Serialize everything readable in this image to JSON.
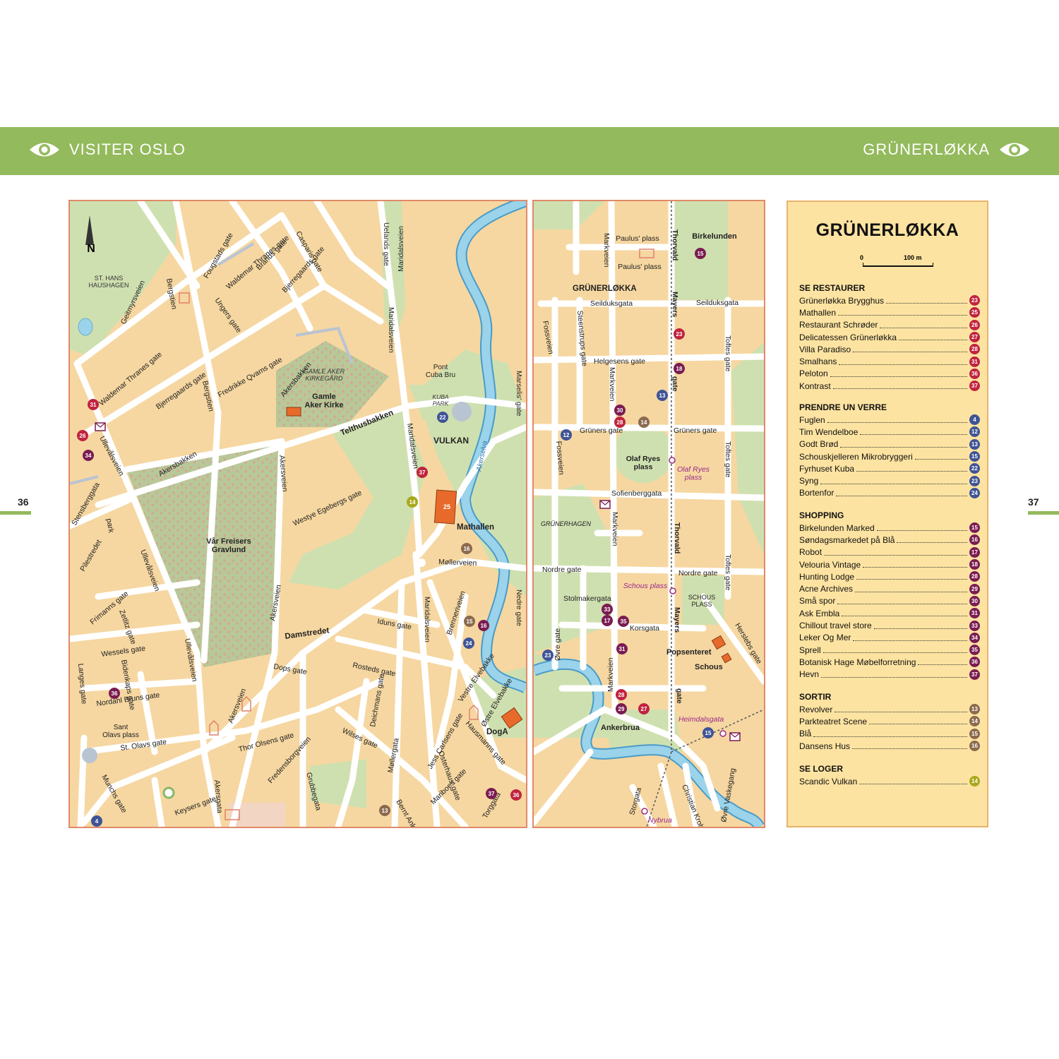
{
  "header": {
    "left_title": "VISITER OSLO",
    "right_title": "GRÜNERLØKKA"
  },
  "page_numbers": {
    "left": "36",
    "right": "37"
  },
  "colors": {
    "header_bar": "#93ba5c",
    "map_background": "#f6d7a1",
    "park": "#cfe0b0",
    "water": "#9ad3ea",
    "legend_background": "#fde3a1",
    "restaurant_badge": "#c0233f",
    "bar_badge": "#3f5496",
    "shopping_badge": "#7a1c52",
    "nightlife_badge": "#8b6a4e",
    "hotel_badge": "#a8a81c"
  },
  "legend": {
    "title": "GRÜNERLØKKA",
    "scale": {
      "zero": "0",
      "distance": "100 m"
    },
    "sections": [
      {
        "heading": "SE RESTAURER",
        "color": "#c0233f",
        "items": [
          {
            "name": "Grünerløkka Brygghus",
            "num": "23"
          },
          {
            "name": "Mathallen",
            "num": "25"
          },
          {
            "name": "Restaurant Schrøder",
            "num": "26"
          },
          {
            "name": "Delicatessen Grünerløkka",
            "num": "27"
          },
          {
            "name": "Villa Paradiso",
            "num": "28"
          },
          {
            "name": "Smalhans",
            "num": "31"
          },
          {
            "name": "Peloton",
            "num": "36"
          },
          {
            "name": "Kontrast",
            "num": "37"
          }
        ]
      },
      {
        "heading": "PRENDRE UN VERRE",
        "color": "#3f5496",
        "items": [
          {
            "name": "Fuglen",
            "num": "4"
          },
          {
            "name": "Tim Wendelboe",
            "num": "12"
          },
          {
            "name": "Godt Brød",
            "num": "13"
          },
          {
            "name": "Schouskjelleren Mikrobryggeri",
            "num": "15"
          },
          {
            "name": "Fyrhuset Kuba",
            "num": "22"
          },
          {
            "name": "Syng",
            "num": "23"
          },
          {
            "name": "Bortenfor",
            "num": "24"
          }
        ]
      },
      {
        "heading": "SHOPPING",
        "color": "#7a1c52",
        "items": [
          {
            "name": "Birkelunden Marked",
            "num": "15"
          },
          {
            "name": "Søndagsmarkedet på Blå",
            "num": "16"
          },
          {
            "name": "Robot",
            "num": "17"
          },
          {
            "name": "Velouria Vintage",
            "num": "18"
          },
          {
            "name": "Hunting Lodge",
            "num": "28"
          },
          {
            "name": "Acne Archives",
            "num": "29"
          },
          {
            "name": "Små spor",
            "num": "30"
          },
          {
            "name": "Ask Embla",
            "num": "31"
          },
          {
            "name": "Chillout travel store",
            "num": "33"
          },
          {
            "name": "Leker Og Mer",
            "num": "34"
          },
          {
            "name": "Sprell",
            "num": "35"
          },
          {
            "name": "Botanisk Hage Møbelforretning",
            "num": "36"
          },
          {
            "name": "Hevn",
            "num": "37"
          }
        ]
      },
      {
        "heading": "SORTIR",
        "color": "#8b6a4e",
        "items": [
          {
            "name": "Revolver",
            "num": "13"
          },
          {
            "name": "Parkteatret Scene",
            "num": "14"
          },
          {
            "name": "Blå",
            "num": "15"
          },
          {
            "name": "Dansens Hus",
            "num": "16"
          }
        ]
      },
      {
        "heading": "SE LOGER",
        "color": "#a8a81c",
        "items": [
          {
            "name": "Scandic Vulkan",
            "num": "14"
          }
        ]
      }
    ]
  },
  "map_left": {
    "compass": "N",
    "places": {
      "st_hans": "ST. HANS\nHAUSHAGEN",
      "gamle_aker_kirkegard": "GAMLE AKER\nKIRKEGÅRD",
      "gamle_aker_kirke": "Gamle\nAker Kirke",
      "var_freisers": "Vår Freisers\nGravlund",
      "vulkan": "VULKAN",
      "kuba_park": "KUBA\nPARK",
      "pont_cuba": "Pont\nCuba Bru",
      "mathallen": "Mathallen",
      "doga": "DogA",
      "sant_olavs": "Sant\nOlavs plass",
      "akerselva": "Akerselva"
    },
    "streets": {
      "fougstads": "Fougstads gate",
      "waldemar1": "Waldemar Thranes gate",
      "casparis": "Casparis gate",
      "brands": "Brands gate",
      "bjerregaards1": "Bjerregaards gate",
      "bergstien1": "Bergstien",
      "geitmyrs": "Geitmyrsveien",
      "ungers": "Ungers gate",
      "waldemar2": "Waldemar Thranes gate",
      "bjerregaards2": "Bjerregaards gate",
      "fredrikke": "Fredrikke Qvams gate",
      "akersbakken1": "Akersbakken",
      "bergstien2": "Bergstien",
      "ullevalsveien1": "Ullevålsveien",
      "akersbakken2": "Akersbakken",
      "telthusbakken": "Telthusbakken",
      "uelands": "Uelands gate",
      "maridalsveien1": "Maridalsveien",
      "maridalsveien2": "Maridalsveien",
      "maridalsveien3": "Maridalsveien",
      "maridalsveien4": "Maridalsveien",
      "stensberg": "Stensberggata",
      "park": "park",
      "akersveien1": "Akersveien",
      "westye": "Westye Egebergs gate",
      "ullevalsveien2": "Ullevålsveien",
      "pilestredet": "Pilestredet",
      "frimanns": "Frimanns gate",
      "zetlitz": "Zetlitz gate",
      "akersveien2": "Akersveien",
      "damstredet": "Damstredet",
      "iduns": "Iduns gate",
      "wessels": "Wessels gate",
      "bidenkaps": "Bidenkaps gate",
      "langes": "Langes gate",
      "nordahl": "Nordahl Bruns gate",
      "dops": "Dops gate",
      "rosteds": "Rosteds gate",
      "akersveien3": "Akersveien",
      "ullevalsveien3": "Ullevålsveien",
      "st_olavs_gate": "St. Olavs gate",
      "thor_olsens": "Thor Olsens gate",
      "fredensborg": "Fredensborgveien",
      "wilses": "Wilses gate",
      "deichmans": "Deichmans gate",
      "mollergata": "Møllergata",
      "jess": "Jess Carlsens gate",
      "hausmanns": "Hausmanns gate",
      "vestre": "Vestre Elvebakke",
      "ostre": "Østre Elvebakke",
      "osterhaus": "Osterhaus' gate",
      "mariboes": "Mariboes gate",
      "torggata": "Torggata",
      "bernt": "Bernt Ankers gate",
      "grubbegata": "Grubbegata",
      "akersgata": "Akersgata",
      "keysers": "Keysers gate",
      "munchs": "Munchs gate",
      "mollerveien": "Møllerveien",
      "brenner": "Brenneriveien",
      "nedre": "Nedre gate",
      "marselis": "Marselis' gate"
    },
    "markers": [
      {
        "num": "31",
        "color": "#c0233f"
      },
      {
        "num": "26",
        "color": "#c0233f"
      },
      {
        "num": "34",
        "color": "#7a1c52"
      },
      {
        "num": "22",
        "color": "#3f5496"
      },
      {
        "num": "37",
        "color": "#c0233f"
      },
      {
        "num": "14",
        "color": "#a8a81c"
      },
      {
        "num": "25",
        "color": "#e86a2a"
      },
      {
        "num": "16",
        "color": "#8b6a4e"
      },
      {
        "num": "16",
        "color": "#7a1c52"
      },
      {
        "num": "15",
        "color": "#8b6a4e"
      },
      {
        "num": "24",
        "color": "#3f5496"
      },
      {
        "num": "36",
        "color": "#7a1c52"
      },
      {
        "num": "37",
        "color": "#7a1c52"
      },
      {
        "num": "36",
        "color": "#c0233f"
      },
      {
        "num": "13",
        "color": "#8b6a4e"
      },
      {
        "num": "4",
        "color": "#3f5496"
      }
    ]
  },
  "map_right": {
    "places": {
      "birkelunden": "Birkelunden",
      "paulus1": "Paulus' plass",
      "paulus2": "Paulus' plass",
      "grunerlokka": "GRÜNERLØKKA",
      "olaf": "Olaf Ryes\nplass",
      "olaf_tram": "Olaf Ryes\nplass",
      "grunerhagen": "GRÜNERHAGEN",
      "schous_plass": "Schous plass",
      "schous_area": "SCHOUS\nPLASS",
      "popsenteret": "Popsenteret",
      "schous": "Schous",
      "ankerbrua": "Ankerbrua",
      "heimdalsgata": "Heimdalsgata",
      "nybrua": "Nybrua"
    },
    "streets": {
      "markveien1": "Markveien",
      "thorvald1": "Thorvald",
      "mayers1": "Mayers",
      "gate1": "gate",
      "thorvald2": "Thorvald",
      "mayers2": "Mayers",
      "gate2": "gate",
      "seilduks1": "Seilduksgata",
      "seilduks2": "Seilduksgata",
      "fossveien1": "Fossveien",
      "steenstrups": "Steenstrups gate",
      "helgesens": "Helgesens gate",
      "markveien2": "Markveien",
      "toftes1": "Toftes gate",
      "gruners1": "Grüners gate",
      "gruners2": "Grüners gate",
      "fossveien2": "Fossveien",
      "toftes2": "Toftes gate",
      "sofienberg": "Sofienberggata",
      "markveien3": "Markveien",
      "nordre1": "Nordre gate",
      "nordre2": "Nordre gate",
      "toftes3": "Toftes gate",
      "stolmaker": "Stolmakergata",
      "ovre": "Øvre gate",
      "korsgata": "Korsgata",
      "markveien4": "Markveien",
      "herslebs": "Herslebs gate",
      "storgata": "Storgata",
      "christian": "Christian Krohgs gate",
      "ovre_vaskegang": "Øvre Vaskegang"
    },
    "markers": [
      {
        "num": "15",
        "color": "#7a1c52"
      },
      {
        "num": "23",
        "color": "#c0233f"
      },
      {
        "num": "18",
        "color": "#7a1c52"
      },
      {
        "num": "13",
        "color": "#3f5496"
      },
      {
        "num": "30",
        "color": "#7a1c52"
      },
      {
        "num": "28",
        "color": "#c0233f"
      },
      {
        "num": "14",
        "color": "#8b6a4e"
      },
      {
        "num": "12",
        "color": "#3f5496"
      },
      {
        "num": "33",
        "color": "#7a1c52"
      },
      {
        "num": "17",
        "color": "#7a1c52"
      },
      {
        "num": "35",
        "color": "#7a1c52"
      },
      {
        "num": "31",
        "color": "#7a1c52"
      },
      {
        "num": "23",
        "color": "#3f5496"
      },
      {
        "num": "28",
        "color": "#c0233f"
      },
      {
        "num": "29",
        "color": "#7a1c52"
      },
      {
        "num": "27",
        "color": "#c0233f"
      },
      {
        "num": "15",
        "color": "#3f5496"
      }
    ]
  }
}
